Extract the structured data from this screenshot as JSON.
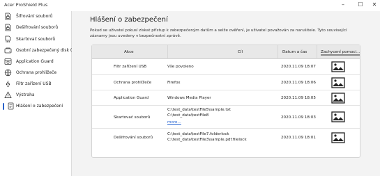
{
  "app": {
    "title": "Acer ProShield Plus"
  },
  "window": {
    "minimize": "–",
    "maximize": "☐",
    "close": "✕"
  },
  "sidebar": {
    "items": [
      {
        "label": "Šifrování souborů",
        "icon": "file-encrypt-icon"
      },
      {
        "label": "Dešifrování souborů",
        "icon": "file-decrypt-icon"
      },
      {
        "label": "Skartovač souborů",
        "icon": "file-shredder-icon"
      },
      {
        "label": "Osobní zabezpečený disk (...",
        "icon": "secure-drive-icon"
      },
      {
        "label": "Application Guard",
        "icon": "application-guard-icon"
      },
      {
        "label": "Ochrana prohlížeče",
        "icon": "browser-protection-icon"
      },
      {
        "label": "Filtr zařízení USB",
        "icon": "usb-filter-icon"
      },
      {
        "label": "Výstraha",
        "icon": "warning-icon"
      },
      {
        "label": "Hlášení o zabezpečení",
        "icon": "security-report-icon",
        "selected": true
      }
    ]
  },
  "main": {
    "title": "Hlášení o zabezpečení",
    "description": "Pokud se uživatel pokusí získat přístup k zabezpečeným datům a selže ověření, je uživatel považován za narušitele. Tyto související záznamy jsou uvedeny v bezpečnostní zprávě."
  },
  "table": {
    "columns": [
      "Akce",
      "Cíl",
      "Datum a čas",
      "Zachycení pomoci..."
    ],
    "rows": [
      {
        "action": "Filtr zařízení USB",
        "target": [
          "Vše povoleno"
        ],
        "datetime": "2020.11.09 18:07"
      },
      {
        "action": "Ochrana prohlížeče",
        "target": [
          "Firefox"
        ],
        "datetime": "2020.11.09 18:06"
      },
      {
        "action": "Application Guard",
        "target": [
          "Windows Media Player"
        ],
        "datetime": "2020.11.09 18:05"
      },
      {
        "action": "Skartovač souborů",
        "target": [
          "C:\\test_data\\testFile5\\sample.txt",
          "C:\\test_data\\testFile8"
        ],
        "more": "more...",
        "datetime": "2020.11.09 18:03"
      },
      {
        "action": "Dešifrování souborů",
        "target": [
          "C:\\test_data\\testFile7.folderlock",
          "C:\\test_data\\testFile3\\sample.pdf.filelock"
        ],
        "datetime": "2020.11.09 18:01"
      }
    ]
  }
}
